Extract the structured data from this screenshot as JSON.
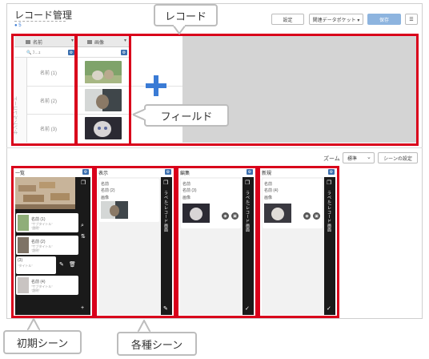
{
  "header": {
    "title": "レコード管理",
    "sub": "● 5",
    "settings_label": "設定",
    "dataset_label": "関連データポケット ▾",
    "save_label": "保存",
    "menu_icon": "☰"
  },
  "grid": {
    "columns": [
      {
        "label": "名前",
        "filter": "🔍 ﾌ…ｪ"
      },
      {
        "label": "画像",
        "filter": ""
      }
    ],
    "rows": [
      "名前 (1)",
      "名前 (2)",
      "名前 (3)"
    ],
    "side_label": "サンプルレコード",
    "add_icon": "plus-icon"
  },
  "callouts": {
    "record": "レコード",
    "field": "フィールド",
    "initial_scene": "初期シーン",
    "scenes": "各種シーン"
  },
  "zoom": {
    "label": "ズーム",
    "value": "標準",
    "scene_settings": "シーンの設定"
  },
  "scenes": [
    {
      "title": "一覧",
      "items": [
        {
          "name": "名前 (1)",
          "sub": "\"サブタイトル\"",
          "note": "\"説明\""
        },
        {
          "name": "名前 (2)",
          "sub": "\"サブタイトル\"",
          "note": "\"説明\""
        },
        {
          "name": "(3)",
          "sub": "\"タイトル\"",
          "note": ""
        },
        {
          "name": "名前 (4)",
          "sub": "\"サブタイトル\"",
          "note": "\"説明\""
        }
      ]
    },
    {
      "title": "表示",
      "fields": [
        "名前",
        "名前 (2)",
        "画像"
      ],
      "side_label": "ラベル/レコード画面"
    },
    {
      "title": "編集",
      "fields": [
        "名前",
        "名前 (3)",
        "画像"
      ],
      "side_label": "ラベル/レコード画面"
    },
    {
      "title": "新規",
      "fields": [
        "名前",
        "名前 (4)",
        "画像"
      ],
      "side_label": "ラベル/レコード画面"
    }
  ],
  "colors": {
    "accent": "#3a7bd5",
    "highlight": "#d9001b",
    "save": "#8db4df"
  }
}
